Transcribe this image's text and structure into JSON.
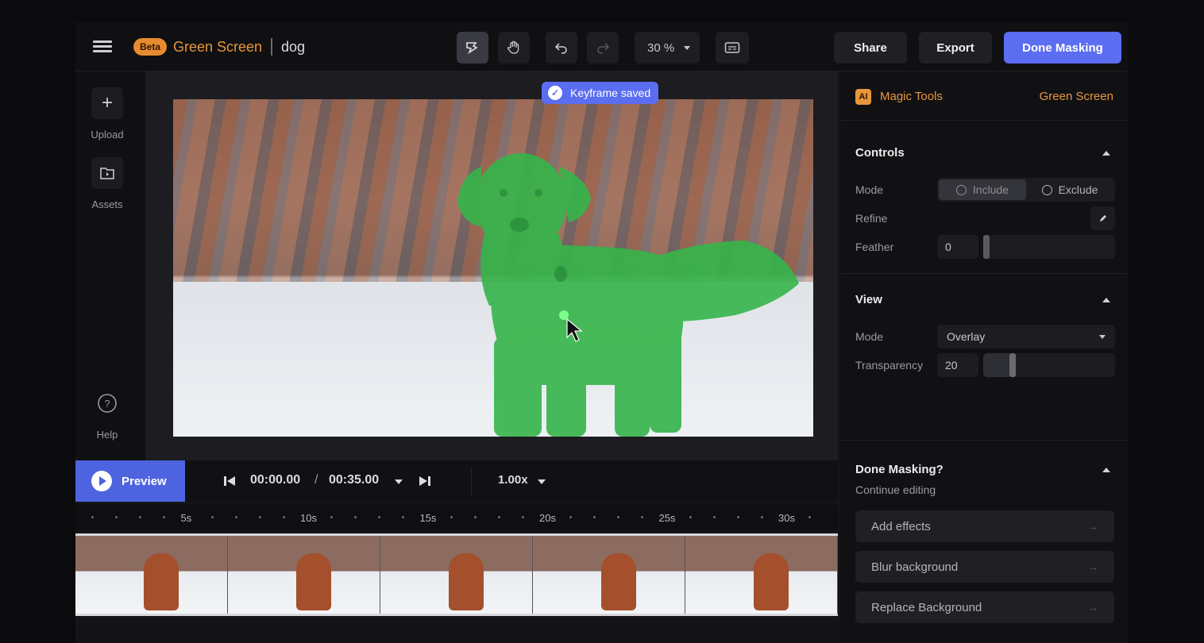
{
  "topbar": {
    "beta_badge": "Beta",
    "project_title": "Green Screen",
    "file_name": "dog",
    "zoom": "30 %",
    "share_label": "Share",
    "export_label": "Export",
    "done_label": "Done Masking"
  },
  "toast": {
    "text": "Keyframe saved"
  },
  "rail": {
    "upload_label": "Upload",
    "assets_label": "Assets",
    "help_label": "Help"
  },
  "transport": {
    "preview_label": "Preview",
    "current_time": "00:00.00",
    "separator": "/",
    "total_time": "00:35.00",
    "speed": "1.00x"
  },
  "timeline": {
    "labels": [
      "5s",
      "10s",
      "15s",
      "20s",
      "25s",
      "30s"
    ]
  },
  "panel": {
    "ai_badge": "AI",
    "magic_tools": "Magic Tools",
    "tool_name": "Green Screen",
    "controls": {
      "title": "Controls",
      "mode_label": "Mode",
      "include_label": "Include",
      "exclude_label": "Exclude",
      "refine_label": "Refine",
      "feather_label": "Feather",
      "feather_value": "0",
      "feather_level": 0
    },
    "view": {
      "title": "View",
      "mode_label": "Mode",
      "mode_value": "Overlay",
      "transparency_label": "Transparency",
      "transparency_value": "20",
      "transparency_level": 0.2
    },
    "done": {
      "title": "Done Masking?",
      "subtitle": "Continue editing",
      "actions": [
        "Add effects",
        "Blur background",
        "Replace Background"
      ]
    }
  },
  "colors": {
    "accent": "#4e63e0",
    "brand_orange": "#e8963a",
    "mask_green": "#35b54a"
  }
}
